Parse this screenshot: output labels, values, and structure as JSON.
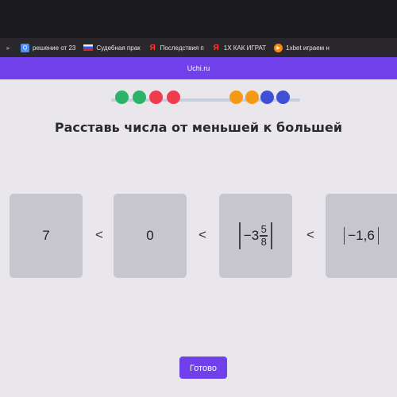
{
  "browser": {
    "tabs": [
      {
        "icon": "search-icon",
        "label": "решение от 23"
      },
      {
        "icon": "flag-icon",
        "label": "Судебная прак"
      },
      {
        "icon": "yandex-icon",
        "label": "Последствия п"
      },
      {
        "icon": "yandex-icon",
        "label": "1Х КАК ИГРАТ"
      },
      {
        "icon": "play-icon",
        "label": "1xbet играем н"
      }
    ],
    "site": "Uchi.ru"
  },
  "progress": {
    "dot_colors": [
      "#2db26a",
      "#2db26a",
      "#f03b4f",
      "#f03b4f",
      "#f59a16",
      "#f59a16",
      "#3f4fd6",
      "#3f4fd6"
    ]
  },
  "task": {
    "title": "Расставь числа от меньшей к большей",
    "cards": {
      "first": "7",
      "second": "0",
      "third": {
        "whole": "−3",
        "numerator": "5",
        "denominator": "8"
      },
      "fourth": "−1,6"
    },
    "separators": [
      "<",
      "<",
      "<"
    ]
  },
  "done_label": "Готово"
}
